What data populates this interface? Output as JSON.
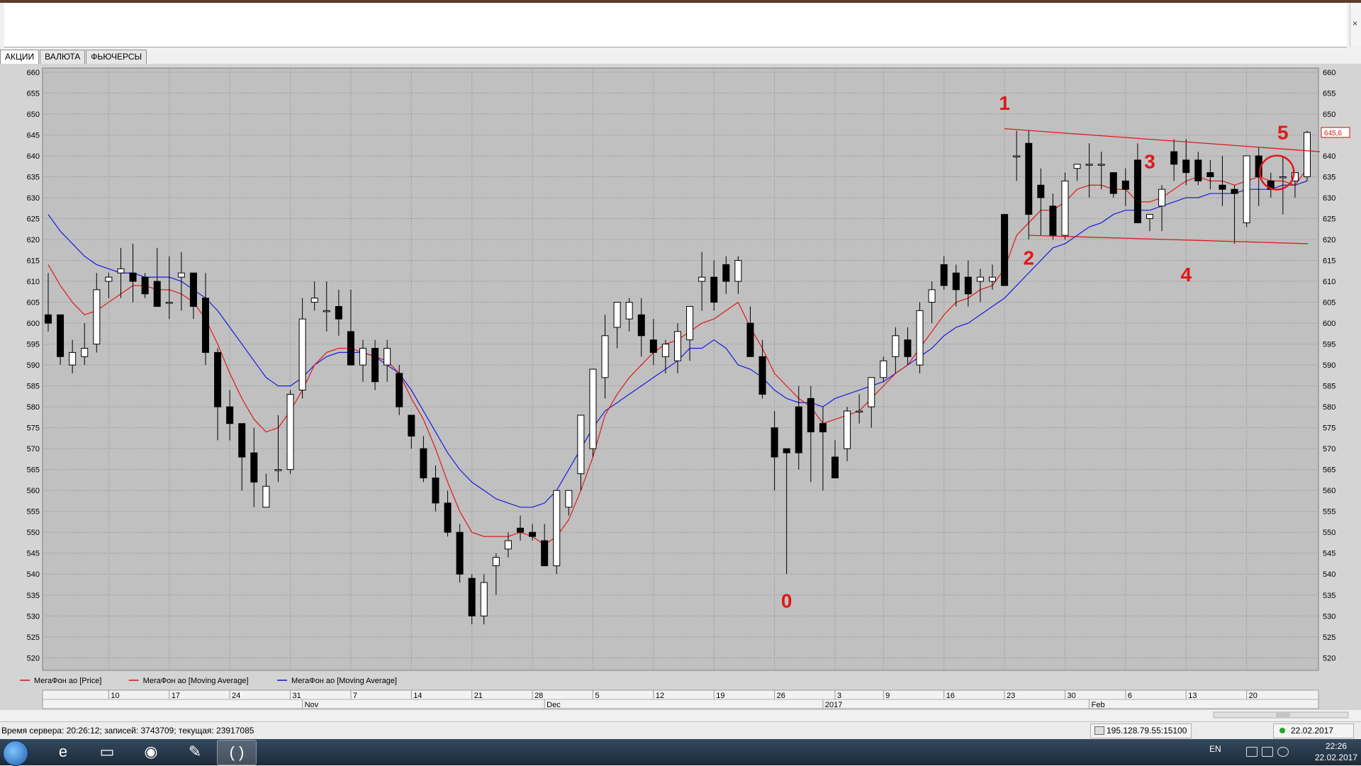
{
  "tabs": [
    "АКЦИИ",
    "ВАЛЮТА",
    "ФЬЮЧЕРСЫ"
  ],
  "active_tab": 0,
  "chart_data": {
    "type": "candlestick",
    "ylim": [
      517,
      661
    ],
    "yticks": [
      520,
      525,
      530,
      535,
      540,
      545,
      550,
      555,
      560,
      565,
      570,
      575,
      580,
      585,
      590,
      595,
      600,
      605,
      610,
      615,
      620,
      625,
      630,
      635,
      640,
      645,
      650,
      655,
      660
    ],
    "last_price_label": "645,6",
    "x_tick_labels": [
      {
        "label": "10",
        "i": 5
      },
      {
        "label": "17",
        "i": 10
      },
      {
        "label": "24",
        "i": 15
      },
      {
        "label": "31",
        "i": 20
      },
      {
        "label": "7",
        "i": 25
      },
      {
        "label": "14",
        "i": 30
      },
      {
        "label": "21",
        "i": 35
      },
      {
        "label": "28",
        "i": 40
      },
      {
        "label": "5",
        "i": 45
      },
      {
        "label": "12",
        "i": 50
      },
      {
        "label": "19",
        "i": 55
      },
      {
        "label": "26",
        "i": 60
      },
      {
        "label": "3",
        "i": 65
      },
      {
        "label": "9",
        "i": 69
      },
      {
        "label": "16",
        "i": 74
      },
      {
        "label": "23",
        "i": 79
      },
      {
        "label": "30",
        "i": 84
      },
      {
        "label": "6",
        "i": 89
      },
      {
        "label": "13",
        "i": 94
      },
      {
        "label": "20",
        "i": 99
      }
    ],
    "month_labels": [
      {
        "label": "Nov",
        "i": 21
      },
      {
        "label": "Dec",
        "i": 41
      },
      {
        "label": "2017",
        "i": 64
      },
      {
        "label": "Feb",
        "i": 86
      }
    ],
    "candles": [
      [
        602,
        612,
        598,
        600
      ],
      [
        602,
        602,
        590,
        592
      ],
      [
        590,
        596,
        588,
        593
      ],
      [
        592,
        600,
        590,
        594
      ],
      [
        595,
        612,
        593,
        608
      ],
      [
        610,
        612,
        606,
        611
      ],
      [
        612,
        618,
        606,
        613
      ],
      [
        612,
        619,
        605,
        610
      ],
      [
        611,
        612,
        606,
        607
      ],
      [
        610,
        618,
        604,
        604
      ],
      [
        605,
        616,
        601,
        605
      ],
      [
        611,
        617,
        603,
        612
      ],
      [
        612,
        612,
        601,
        604
      ],
      [
        606,
        612,
        590,
        593
      ],
      [
        593,
        594,
        572,
        580
      ],
      [
        580,
        584,
        572,
        576
      ],
      [
        576,
        576,
        560,
        568
      ],
      [
        569,
        575,
        556,
        562
      ],
      [
        556,
        564,
        556,
        561
      ],
      [
        565,
        578,
        562,
        565
      ],
      [
        565,
        584,
        564,
        583
      ],
      [
        584,
        606,
        582,
        601
      ],
      [
        605,
        610,
        603,
        606
      ],
      [
        603,
        610,
        598,
        603
      ],
      [
        604,
        608,
        597,
        601
      ],
      [
        598,
        608,
        590,
        590
      ],
      [
        590,
        596,
        586,
        594
      ],
      [
        594,
        596,
        584,
        586
      ],
      [
        590,
        596,
        586,
        594
      ],
      [
        588,
        590,
        578,
        580
      ],
      [
        578,
        578,
        570,
        573
      ],
      [
        570,
        573,
        562,
        563
      ],
      [
        563,
        566,
        555,
        557
      ],
      [
        557,
        560,
        549,
        550
      ],
      [
        550,
        552,
        538,
        540
      ],
      [
        539,
        540,
        528,
        530
      ],
      [
        530,
        540,
        528,
        538
      ],
      [
        542,
        545,
        535,
        544
      ],
      [
        546,
        550,
        544,
        548
      ],
      [
        551,
        554,
        548,
        550
      ],
      [
        550,
        552,
        548,
        549
      ],
      [
        548,
        552,
        542,
        542
      ],
      [
        542,
        560,
        540,
        560
      ],
      [
        556,
        560,
        554,
        560
      ],
      [
        564,
        578,
        560,
        578
      ],
      [
        570,
        589,
        568,
        589
      ],
      [
        587,
        602,
        582,
        597
      ],
      [
        599,
        605,
        594,
        605
      ],
      [
        601,
        606,
        598,
        605
      ],
      [
        602,
        606,
        592,
        597
      ],
      [
        596,
        601,
        590,
        593
      ],
      [
        592,
        596,
        588,
        595
      ],
      [
        591,
        600,
        588,
        598
      ],
      [
        596,
        604,
        591,
        604
      ],
      [
        610,
        617,
        603,
        611
      ],
      [
        611,
        615,
        603,
        605
      ],
      [
        614,
        616,
        607,
        610
      ],
      [
        610,
        616,
        607,
        615
      ],
      [
        600,
        604,
        594,
        592
      ],
      [
        592,
        596,
        582,
        583
      ],
      [
        575,
        579,
        560,
        568
      ],
      [
        570,
        570,
        540,
        569
      ],
      [
        580,
        585,
        565,
        569
      ],
      [
        582,
        585,
        562,
        574
      ],
      [
        576,
        580,
        560,
        574
      ],
      [
        568,
        572,
        563,
        563
      ],
      [
        570,
        580,
        567,
        579
      ],
      [
        579,
        583,
        576,
        579
      ],
      [
        580,
        584,
        575,
        587
      ],
      [
        587,
        592,
        586,
        591
      ],
      [
        592,
        599,
        588,
        597
      ],
      [
        596,
        599,
        590,
        592
      ],
      [
        590,
        605,
        588,
        603
      ],
      [
        605,
        610,
        600,
        608
      ],
      [
        614,
        616,
        608,
        609
      ],
      [
        612,
        614,
        604,
        608
      ],
      [
        611,
        615,
        604,
        607
      ],
      [
        610,
        613,
        605,
        611
      ],
      [
        610,
        614,
        608,
        611
      ],
      [
        626,
        626,
        610,
        609
      ],
      [
        640,
        646,
        634,
        640
      ],
      [
        643,
        646,
        620,
        626
      ],
      [
        633,
        637,
        621,
        630
      ],
      [
        628,
        631,
        620,
        621
      ],
      [
        621,
        636,
        620,
        634
      ],
      [
        637,
        638,
        634,
        638
      ],
      [
        638,
        643,
        630,
        638
      ],
      [
        638,
        641,
        632,
        638
      ],
      [
        636,
        636,
        630,
        631
      ],
      [
        634,
        637,
        628,
        632
      ],
      [
        639,
        643,
        624,
        624
      ],
      [
        625,
        626,
        622,
        626
      ],
      [
        628,
        633,
        622,
        632
      ],
      [
        641,
        644,
        634,
        638
      ],
      [
        639,
        644,
        633,
        636
      ],
      [
        639,
        641,
        633,
        634
      ],
      [
        636,
        639,
        632,
        635
      ],
      [
        633,
        640,
        628,
        632
      ],
      [
        632,
        633,
        619,
        631
      ],
      [
        624,
        640,
        623,
        640
      ],
      [
        640,
        642,
        628,
        635
      ],
      [
        634,
        636,
        630,
        632
      ],
      [
        635,
        640,
        626,
        635
      ],
      [
        634,
        636,
        630,
        636
      ],
      [
        635,
        646,
        634,
        645.6
      ]
    ],
    "ma_red": [
      [
        0,
        614
      ],
      [
        1,
        609
      ],
      [
        2,
        605
      ],
      [
        3,
        602
      ],
      [
        4,
        603
      ],
      [
        5,
        605
      ],
      [
        6,
        607
      ],
      [
        7,
        609
      ],
      [
        8,
        609
      ],
      [
        9,
        608
      ],
      [
        10,
        608
      ],
      [
        11,
        607
      ],
      [
        12,
        605
      ],
      [
        13,
        601
      ],
      [
        14,
        595
      ],
      [
        15,
        588
      ],
      [
        16,
        582
      ],
      [
        17,
        577
      ],
      [
        18,
        574
      ],
      [
        19,
        575
      ],
      [
        20,
        579
      ],
      [
        21,
        584
      ],
      [
        22,
        590
      ],
      [
        23,
        593
      ],
      [
        24,
        594
      ],
      [
        25,
        594
      ],
      [
        26,
        593
      ],
      [
        27,
        592
      ],
      [
        28,
        591
      ],
      [
        29,
        588
      ],
      [
        30,
        582
      ],
      [
        31,
        577
      ],
      [
        32,
        570
      ],
      [
        33,
        562
      ],
      [
        34,
        555
      ],
      [
        35,
        550
      ],
      [
        36,
        549
      ],
      [
        37,
        549
      ],
      [
        38,
        549
      ],
      [
        39,
        550
      ],
      [
        40,
        549
      ],
      [
        41,
        547
      ],
      [
        42,
        549
      ],
      [
        43,
        553
      ],
      [
        44,
        560
      ],
      [
        45,
        568
      ],
      [
        46,
        578
      ],
      [
        47,
        583
      ],
      [
        48,
        587
      ],
      [
        49,
        590
      ],
      [
        50,
        593
      ],
      [
        51,
        595
      ],
      [
        52,
        596
      ],
      [
        53,
        598
      ],
      [
        54,
        600
      ],
      [
        55,
        601
      ],
      [
        56,
        603
      ],
      [
        57,
        605
      ],
      [
        58,
        599
      ],
      [
        59,
        594
      ],
      [
        60,
        588
      ],
      [
        61,
        585
      ],
      [
        62,
        582
      ],
      [
        63,
        580
      ],
      [
        64,
        576
      ],
      [
        65,
        577
      ],
      [
        66,
        578
      ],
      [
        67,
        579
      ],
      [
        68,
        582
      ],
      [
        69,
        585
      ],
      [
        70,
        588
      ],
      [
        71,
        590
      ],
      [
        72,
        594
      ],
      [
        73,
        598
      ],
      [
        74,
        602
      ],
      [
        75,
        605
      ],
      [
        76,
        606
      ],
      [
        77,
        608
      ],
      [
        78,
        609
      ],
      [
        79,
        613
      ],
      [
        80,
        621
      ],
      [
        81,
        624
      ],
      [
        82,
        627
      ],
      [
        83,
        627
      ],
      [
        84,
        629
      ],
      [
        85,
        632
      ],
      [
        86,
        633
      ],
      [
        87,
        633
      ],
      [
        88,
        632
      ],
      [
        89,
        632
      ],
      [
        90,
        629
      ],
      [
        91,
        629
      ],
      [
        92,
        630
      ],
      [
        93,
        632
      ],
      [
        94,
        634
      ],
      [
        95,
        635
      ],
      [
        96,
        634
      ],
      [
        97,
        634
      ],
      [
        98,
        633
      ],
      [
        99,
        634
      ],
      [
        100,
        635
      ],
      [
        101,
        634
      ],
      [
        102,
        634
      ],
      [
        103,
        633
      ],
      [
        104,
        637
      ]
    ],
    "ma_blue": [
      [
        0,
        626
      ],
      [
        1,
        622
      ],
      [
        2,
        619
      ],
      [
        3,
        616
      ],
      [
        4,
        614
      ],
      [
        5,
        613
      ],
      [
        6,
        612
      ],
      [
        7,
        612
      ],
      [
        8,
        611
      ],
      [
        9,
        611
      ],
      [
        10,
        611
      ],
      [
        11,
        610
      ],
      [
        12,
        608
      ],
      [
        13,
        606
      ],
      [
        14,
        603
      ],
      [
        15,
        599
      ],
      [
        16,
        595
      ],
      [
        17,
        591
      ],
      [
        18,
        587
      ],
      [
        19,
        585
      ],
      [
        20,
        585
      ],
      [
        21,
        587
      ],
      [
        22,
        590
      ],
      [
        23,
        592
      ],
      [
        24,
        593
      ],
      [
        25,
        593
      ],
      [
        26,
        593
      ],
      [
        27,
        592
      ],
      [
        28,
        590
      ],
      [
        29,
        588
      ],
      [
        30,
        584
      ],
      [
        31,
        579
      ],
      [
        32,
        574
      ],
      [
        33,
        569
      ],
      [
        34,
        565
      ],
      [
        35,
        562
      ],
      [
        36,
        560
      ],
      [
        37,
        558
      ],
      [
        38,
        557
      ],
      [
        39,
        556
      ],
      [
        40,
        556
      ],
      [
        41,
        557
      ],
      [
        42,
        560
      ],
      [
        43,
        565
      ],
      [
        44,
        570
      ],
      [
        45,
        575
      ],
      [
        46,
        579
      ],
      [
        47,
        581
      ],
      [
        48,
        583
      ],
      [
        49,
        585
      ],
      [
        50,
        587
      ],
      [
        51,
        589
      ],
      [
        52,
        591
      ],
      [
        53,
        594
      ],
      [
        54,
        594
      ],
      [
        55,
        596
      ],
      [
        56,
        594
      ],
      [
        57,
        590
      ],
      [
        58,
        589
      ],
      [
        59,
        587
      ],
      [
        60,
        584
      ],
      [
        61,
        582
      ],
      [
        62,
        581
      ],
      [
        63,
        581
      ],
      [
        64,
        580
      ],
      [
        65,
        582
      ],
      [
        66,
        583
      ],
      [
        67,
        584
      ],
      [
        68,
        585
      ],
      [
        69,
        586
      ],
      [
        70,
        588
      ],
      [
        71,
        590
      ],
      [
        72,
        592
      ],
      [
        73,
        594
      ],
      [
        74,
        597
      ],
      [
        75,
        599
      ],
      [
        76,
        600
      ],
      [
        77,
        602
      ],
      [
        78,
        604
      ],
      [
        79,
        606
      ],
      [
        80,
        609
      ],
      [
        81,
        612
      ],
      [
        82,
        615
      ],
      [
        83,
        618
      ],
      [
        84,
        619
      ],
      [
        85,
        621
      ],
      [
        86,
        623
      ],
      [
        87,
        624
      ],
      [
        88,
        626
      ],
      [
        89,
        627
      ],
      [
        90,
        627
      ],
      [
        91,
        627
      ],
      [
        92,
        628
      ],
      [
        93,
        629
      ],
      [
        94,
        630
      ],
      [
        95,
        630
      ],
      [
        96,
        631
      ],
      [
        97,
        631
      ],
      [
        98,
        631
      ],
      [
        99,
        632
      ],
      [
        100,
        632
      ],
      [
        101,
        632
      ],
      [
        102,
        633
      ],
      [
        103,
        633
      ],
      [
        104,
        634
      ]
    ],
    "resistance_line": [
      [
        79,
        646.5
      ],
      [
        104,
        641
      ]
    ],
    "support_line": [
      [
        81,
        621
      ],
      [
        103,
        619
      ]
    ],
    "annotations": [
      {
        "text": "0",
        "i": 61,
        "y": 532
      },
      {
        "text": "1",
        "i": 79,
        "y": 651
      },
      {
        "text": "2",
        "i": 81,
        "y": 614
      },
      {
        "text": "3",
        "i": 91,
        "y": 637
      },
      {
        "text": "4",
        "i": 94,
        "y": 610
      },
      {
        "text": "5",
        "i": 102,
        "y": 644
      }
    ],
    "highlight_circle": {
      "i": 101.5,
      "y": 636
    },
    "legend": [
      {
        "name": "МегаФон ао [Price]",
        "color": "#d01010"
      },
      {
        "name": "МегаФон ао [Moving Average]",
        "color": "#d01010"
      },
      {
        "name": "МегаФон ао [Moving Average]",
        "color": "#1010d0"
      }
    ],
    "colors": {
      "bull": "#ffffff",
      "bear": "#000000",
      "ma_red": "#e01818",
      "ma_blue": "#1a1ae0",
      "annotation": "#e01818",
      "plot_bg": "#c0c0c0"
    }
  },
  "status": {
    "server": "Время сервера: 20:26:12; записей: 3743709; текущая: 23917085",
    "ip": "195.128.79.55:15100",
    "date": "22.02.2017"
  },
  "taskbar": {
    "lang": "EN",
    "time": "22:26",
    "date": "22.02.2017",
    "apps": [
      "ie-icon",
      "folder-icon",
      "chrome-icon",
      "paint-icon",
      "terminal-icon"
    ]
  }
}
